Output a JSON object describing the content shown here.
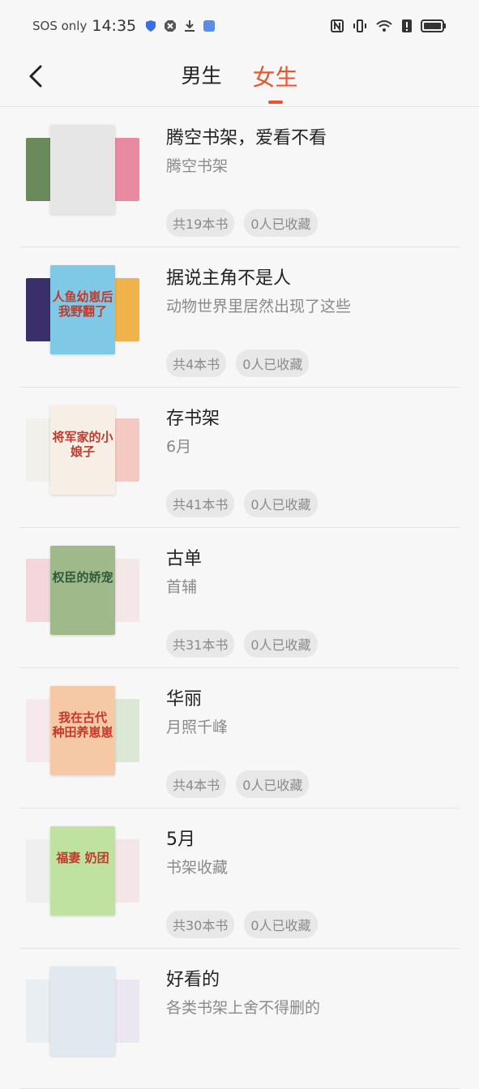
{
  "statusbar": {
    "sos": "SOS only",
    "time": "14:35"
  },
  "tabs": [
    {
      "label": "男生",
      "active": false
    },
    {
      "label": "女生",
      "active": true
    }
  ],
  "shelves": [
    {
      "title": "腾空书架，爱看不看",
      "desc": "腾空书架",
      "count": "共19本书",
      "fav": "0人已收藏",
      "covers": {
        "left": "#6b8a5c",
        "mid": "#e6e6e6",
        "right": "#e98aa1",
        "mid_text": ""
      }
    },
    {
      "title": "据说主角不是人",
      "desc": "动物世界里居然出现了这些",
      "count": "共4本书",
      "fav": "0人已收藏",
      "covers": {
        "left": "#3a2f6b",
        "mid": "#7fc8e6",
        "right": "#f0b24a",
        "mid_text": "人鱼幼崽后 我野翻了"
      }
    },
    {
      "title": "存书架",
      "desc": "6月",
      "count": "共41本书",
      "fav": "0人已收藏",
      "covers": {
        "left": "#f2f0ea",
        "mid": "#f7efe6",
        "right": "#f3c9c1",
        "mid_text": "将军家的小娘子"
      }
    },
    {
      "title": "古单",
      "desc": "首辅",
      "count": "共31本书",
      "fav": "0人已收藏",
      "covers": {
        "left": "#f3d7da",
        "mid": "#9fb98a",
        "right": "#f5e7e7",
        "mid_text": "权臣的娇宠"
      }
    },
    {
      "title": "华丽",
      "desc": "月照千峰",
      "count": "共4本书",
      "fav": "0人已收藏",
      "covers": {
        "left": "#f5e9ee",
        "mid": "#f6c9a6",
        "right": "#dbe8d6",
        "mid_text": "我在古代 种田养崽崽"
      }
    },
    {
      "title": "5月",
      "desc": "书架收藏",
      "count": "共30本书",
      "fav": "0人已收藏",
      "covers": {
        "left": "#efefef",
        "mid": "#bfe2a0",
        "right": "#f4e6e6",
        "mid_text": "福妻 奶团"
      }
    },
    {
      "title": "好看的",
      "desc": "各类书架上舍不得删的",
      "count": "",
      "fav": "",
      "covers": {
        "left": "#e9eef2",
        "mid": "#dfe9ef",
        "right": "#ece6f0",
        "mid_text": ""
      }
    }
  ],
  "colors": {
    "accent": "#e8552f"
  }
}
